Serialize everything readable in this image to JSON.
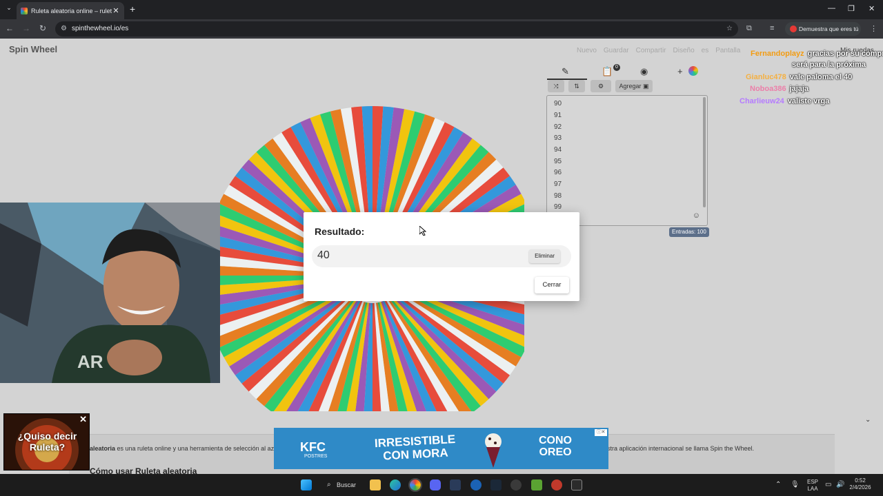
{
  "browser": {
    "tab_title": "Ruleta aleatoria online – ruleta",
    "url": "spinthewheel.io/es",
    "verify_label": "Demuestra que eres tú"
  },
  "site": {
    "logo": "Spin Wheel",
    "nav": [
      "Nuevo",
      "Guardar",
      "Compartir",
      "Diseño",
      "es",
      "Pantalla"
    ],
    "my_wheels": "Mis ruedas"
  },
  "wheel": {
    "colors": [
      "#e74c3c",
      "#3498db",
      "#9b59b6",
      "#f1c40f",
      "#2ecc71",
      "#e67e22",
      "#ecf0f1"
    ]
  },
  "editor": {
    "add_label": "Agregar",
    "entries": [
      "90",
      "91",
      "92",
      "93",
      "94",
      "95",
      "96",
      "97",
      "98",
      "99"
    ],
    "entries_count": "Entradas: 100",
    "badge": "0"
  },
  "chat": [
    {
      "user": "Fernandoplayz",
      "user_color": "#f39c12",
      "message": "gracias por su compra"
    },
    {
      "user": "",
      "user_color": "#ffffff",
      "message": "será para la próxima"
    },
    {
      "user": "Gianluc478",
      "user_color": "#f5b041",
      "message": "vale paloma el 40"
    },
    {
      "user": "Noboa386",
      "user_color": "#ec7fa9",
      "message": "jajaja"
    },
    {
      "user": "Charlieuw24",
      "user_color": "#b57bff",
      "message": "valiste vrga"
    }
  ],
  "modal": {
    "title": "Resultado:",
    "result": "40",
    "delete_label": "Eliminar",
    "close_label": "Cerrar"
  },
  "article": {
    "bold": "aleatoria",
    "text": " es una ruleta online y una herramienta de selección al azar. Con ella puedes crear tus propias entradas, aplica temas y cambia los sonidos, y deja que la suerte decida por ti. Nuestra aplicación internacional se llama Spin the Wheel.",
    "next_heading": "Cómo usar Ruleta aleatoria"
  },
  "promo": {
    "text": "¿Quiso decir Ruleta?"
  },
  "ad": {
    "brand": "KFC",
    "brand_sub": "POSTRES",
    "slogan": "IRRESISTIBLE CON MORA",
    "product": "CONO OREO"
  },
  "taskbar": {
    "search_label": "Buscar",
    "lang_line1": "ESP",
    "lang_line2": "LAA",
    "time": "0:52",
    "date": "2/4/2026"
  }
}
